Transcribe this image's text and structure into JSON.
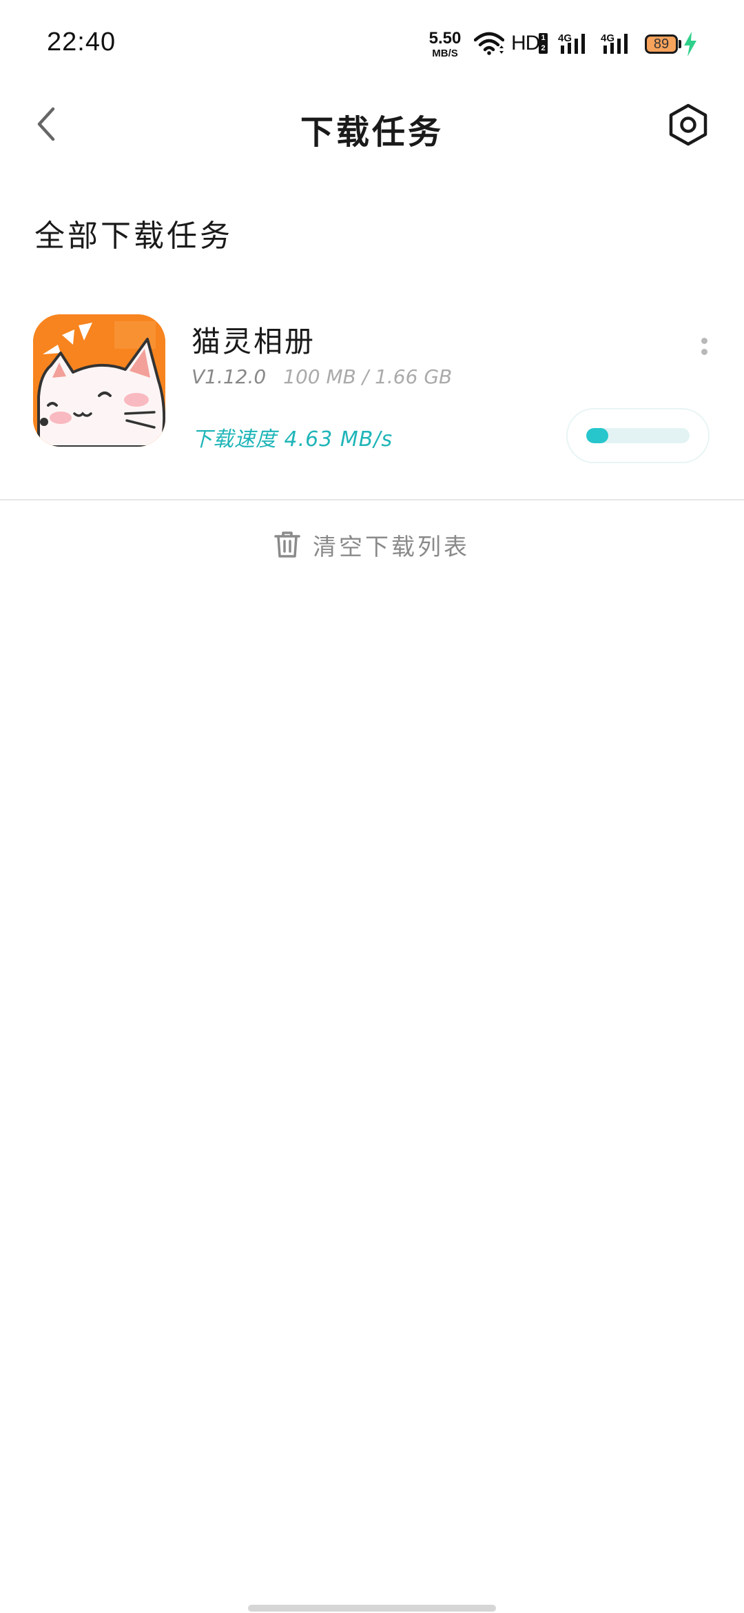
{
  "status_bar": {
    "time": "22:40",
    "net_speed_value": "5.50",
    "net_speed_unit": "MB/S",
    "hd_label": "HD",
    "hd_sub": "1 2",
    "signal_1_label": "4G",
    "signal_2_label": "4G",
    "battery_level": "89",
    "icons": [
      "wifi-icon",
      "signal-icon",
      "signal-icon",
      "battery-icon",
      "charging-bolt-icon"
    ]
  },
  "header": {
    "title": "下载任务",
    "back_icon": "chevron-left-icon",
    "settings_icon": "hexagon-gear-icon"
  },
  "section": {
    "title": "全部下载任务"
  },
  "downloads": [
    {
      "app_name": "猫灵相册",
      "version": "V1.12.0",
      "progress_text": "100 MB / 1.66 GB",
      "speed_text": "下载速度 4.63 MB/s",
      "progress_fraction": 0.06,
      "icon": "cat-app-icon",
      "more_icon": "more-vertical-icon"
    }
  ],
  "footer": {
    "clear_label": "清空下载列表",
    "clear_icon": "trash-icon"
  },
  "colors": {
    "accent": "#1fb5b8",
    "progress_fill": "#27c6cc",
    "progress_track": "#e3f3f3",
    "icon_orange": "#f7841e"
  }
}
